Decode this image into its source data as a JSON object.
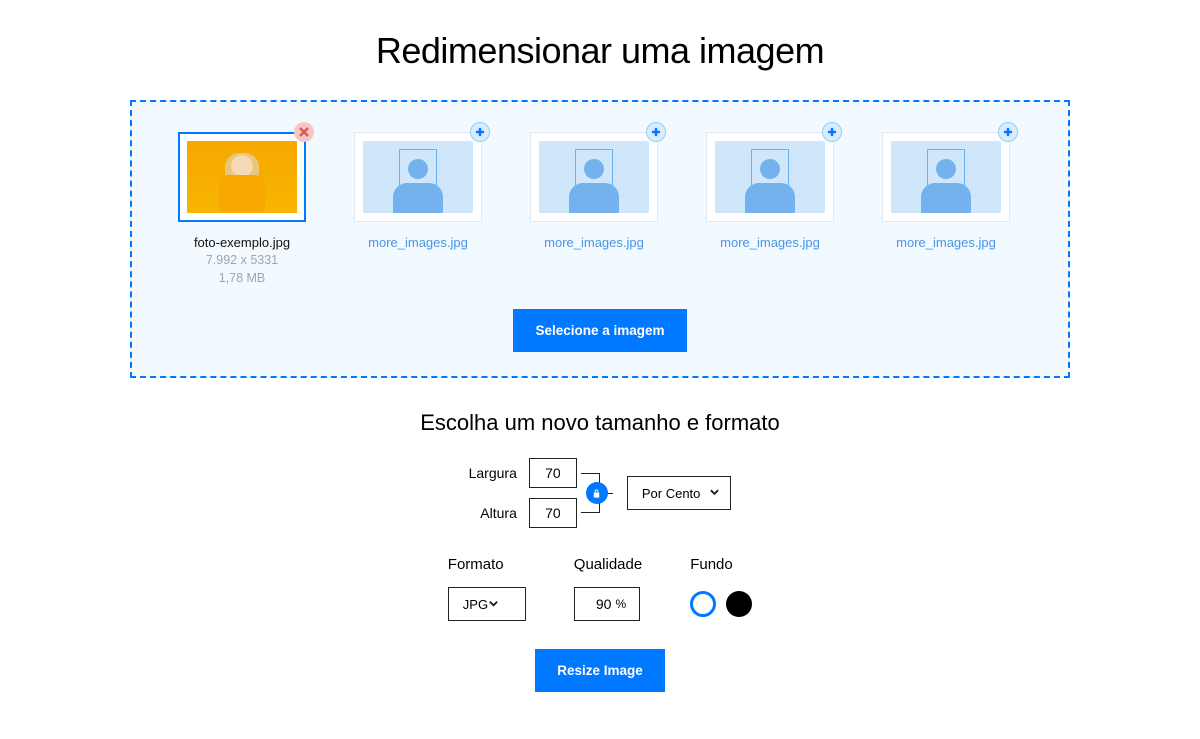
{
  "title": "Redimensionar uma imagem",
  "dropzone": {
    "uploaded": {
      "filename": "foto-exemplo.jpg",
      "dimensions": "7.992 x 5331",
      "filesize": "1,78 MB"
    },
    "placeholders": [
      {
        "filename": "more_images.jpg"
      },
      {
        "filename": "more_images.jpg"
      },
      {
        "filename": "more_images.jpg"
      },
      {
        "filename": "more_images.jpg"
      }
    ],
    "select_button": "Selecione a imagem"
  },
  "section_title": "Escolha um novo tamanho e formato",
  "dims": {
    "width_label": "Largura",
    "width_value": "70",
    "height_label": "Altura",
    "height_value": "70",
    "unit_label": "Por Cento"
  },
  "format": {
    "label": "Formato",
    "value": "JPG"
  },
  "quality": {
    "label": "Qualidade",
    "value": "90",
    "suffix": "%"
  },
  "background": {
    "label": "Fundo"
  },
  "resize_button": "Resize Image"
}
